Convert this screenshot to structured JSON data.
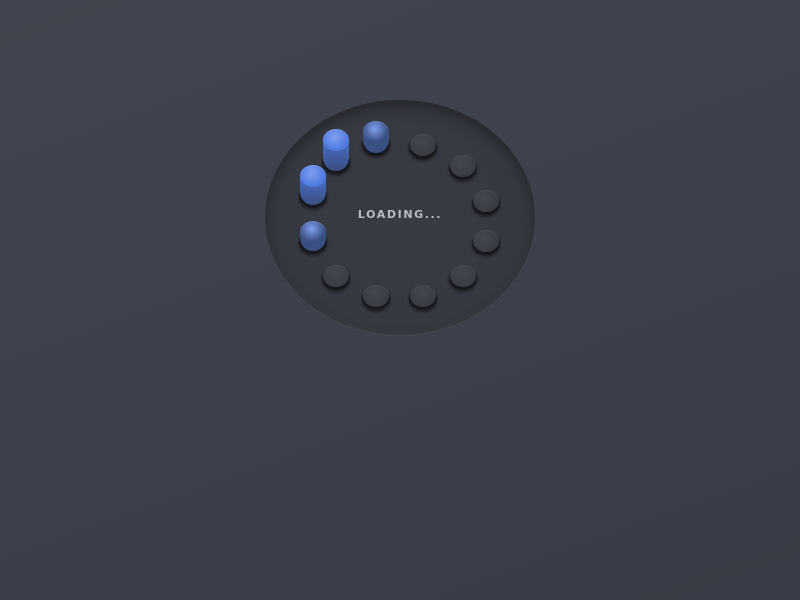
{
  "loader": {
    "label": "LOADING...",
    "total_dots": 12,
    "active_index": 0,
    "colors": {
      "lit_bright": "#4f7ae0",
      "lit_mid": "#3f66c4",
      "lit_dim": "#3a4f82",
      "idle": "#3a3c44"
    }
  }
}
